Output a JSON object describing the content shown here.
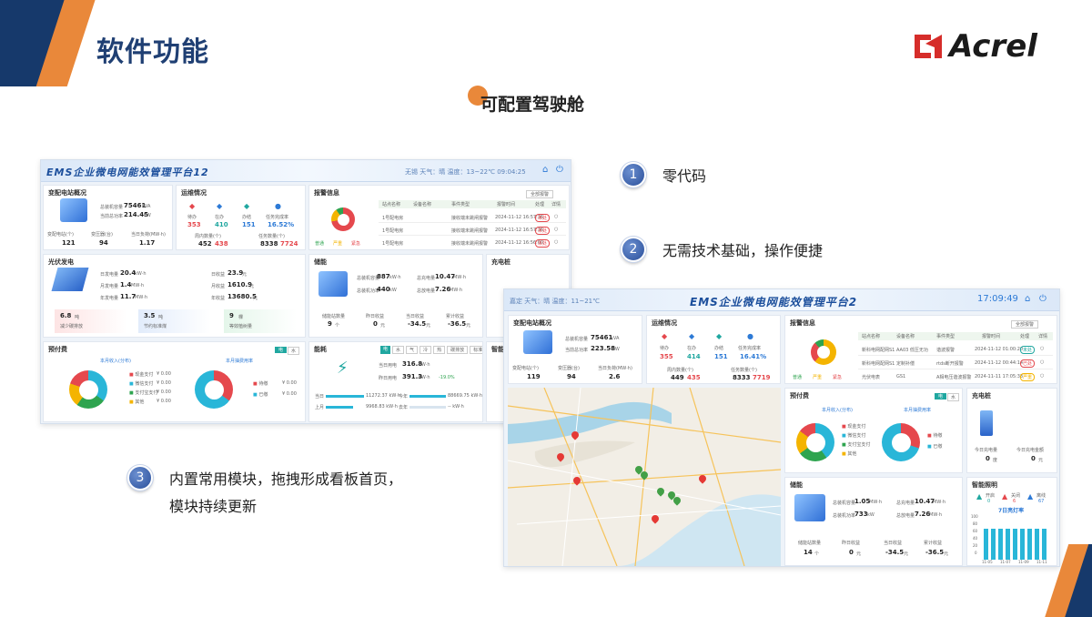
{
  "slide": {
    "title": "软件功能",
    "subtitle": "可配置驾驶舱",
    "brand": "Acrel"
  },
  "features": [
    {
      "num": "1",
      "text": "零代码"
    },
    {
      "num": "2",
      "text": "无需技术基础，操作便捷"
    },
    {
      "num": "3",
      "line1": "内置常用模块，拖拽形成看板首页，",
      "line2": "模块持续更新"
    }
  ],
  "dash1": {
    "title": "EMS企业微电网能效管理平台12",
    "weather": "无锡 天气：晴 温度：13~22℃ 09:04:25",
    "substation": {
      "title": "变配电站概况",
      "cap_label": "总装机容量",
      "cap_value": "75461",
      "cap_unit": "kVA",
      "load_label": "当前总功率",
      "load_value": "214.45",
      "load_unit": "kW",
      "s1_label": "变配电站(个)",
      "s1_value": "121",
      "s2_label": "变压器(台)",
      "s2_value": "94",
      "s3_label": "当日负荷(MW·h)",
      "s3_value": "1.17"
    },
    "ops": {
      "title": "运维情况",
      "items": [
        {
          "label": "待办",
          "value": "353"
        },
        {
          "label": "在办",
          "value": "410"
        },
        {
          "label": "办结",
          "value": "151"
        },
        {
          "label": "任务完成率",
          "value": "16.52%"
        }
      ],
      "a_label": "周内数量(个)",
      "a_value": "452",
      "a_extra": "438",
      "b_label": "任务数量(个)",
      "b_value": "8338",
      "b_extra": "7724"
    },
    "alarm": {
      "title": "报警信息",
      "filter": "全部报警",
      "cols": [
        "站点名称",
        "设备名称",
        "事件类型",
        "报警时间",
        "处理",
        "详情"
      ],
      "rows": [
        {
          "site": "1号配电房",
          "event": "接收端未跳闸报警",
          "time": "2024-11-12 16:57:36",
          "state": "未处"
        },
        {
          "site": "1号配电房",
          "event": "接收端未跳闸报警",
          "time": "2024-11-12 16:57:36",
          "state": "未处"
        },
        {
          "site": "1号配电房",
          "event": "接收端未跳闸报警",
          "time": "2024-11-12 16:56:00",
          "state": "未处"
        }
      ],
      "legend": [
        "普通",
        "严重",
        "紧急"
      ]
    },
    "pv": {
      "title": "光伏发电",
      "d_label": "日发电量",
      "d_value": "20.4",
      "d_unit": "kW·h",
      "m_label": "月发电量",
      "m_value": "1.4",
      "m_unit": "MW·h",
      "y_label": "年发电量",
      "y_value": "11.7",
      "y_unit": "MW·h",
      "di_label": "日收益",
      "di_value": "23.9",
      "mi_label": "月收益",
      "mi_value": "1610.9",
      "yi_label": "年收益",
      "yi_value": "13680.5",
      "unit_yuan": "元",
      "c1_value": "6.8",
      "c1_unit": "吨",
      "c1_label": "减少碳排放",
      "c2_value": "3.5",
      "c2_unit": "吨",
      "c2_label": "节约标准煤",
      "c3_value": "9",
      "c3_unit": "棵",
      "c3_label": "等效植树量"
    },
    "storage": {
      "title": "储能",
      "cap_label": "总装机容量",
      "cap_value": "887",
      "cap_unit": "kW·h",
      "pw_label": "总装机功率",
      "pw_value": "440",
      "pw_unit": "kW",
      "chg_label": "总充电量",
      "chg_value": "10.47",
      "chg_unit": "MW·h",
      "dis_label": "总放电量",
      "dis_value": "7.26",
      "dis_unit": "MW·h",
      "n1_label": "储能站数量",
      "n1_value": "9",
      "n1_unit": "个",
      "n2_label": "昨日收益",
      "n2_value": "0",
      "n3_label": "当日收益",
      "n3_value": "-34.5",
      "n4_label": "累计收益",
      "n4_value": "-36.5",
      "unit_yuan": "元"
    },
    "charge": {
      "title": "充电桩"
    },
    "prepaid": {
      "title": "预付费",
      "tab1": "电",
      "tab2": "水",
      "left_label": "本月收入(分布)",
      "right_label": "本月抽费用率",
      "legend_l": [
        "现金支付",
        "微信支付",
        "支付宝支付",
        "其他"
      ],
      "legend_r": [
        "待缴",
        "已缴"
      ],
      "zero": "¥ 0.00"
    },
    "energy": {
      "title": "能耗",
      "tabs": [
        "电",
        "水",
        "气",
        "冷",
        "热",
        "碳排放",
        "标准煤"
      ],
      "today_label": "当日用电",
      "today_value": "316.8",
      "today_unit": "kW·h",
      "yest_label": "昨日用电",
      "yest_value": "391.3",
      "yest_unit": "kW·h",
      "ratio": "-19.0%",
      "r1": "当日",
      "r1v": "11272.37 kW·h",
      "r2": "上月",
      "r2v": "9968.83 kW·h",
      "r3": "今年",
      "r3v": "88669.75 kW·h",
      "r4": "去年",
      "r4v": "-- kW·h"
    },
    "smart": {
      "title": "智能"
    }
  },
  "dash2": {
    "title": "EMS企业微电网能效管理平台2",
    "weather": "嘉定 天气：晴 温度：11~21℃",
    "clock": "17:09:49",
    "substation": {
      "title": "变配电站概况",
      "cap_label": "总装机容量",
      "cap_value": "75461",
      "cap_unit": "kVA",
      "load_label": "当前总功率",
      "load_value": "223.58",
      "load_unit": "kW",
      "s1_label": "变配电站(个)",
      "s1_value": "119",
      "s2_label": "变压器(台)",
      "s2_value": "94",
      "s3_label": "当日负荷(MW·h)",
      "s3_value": "2.6"
    },
    "ops": {
      "title": "运维情况",
      "items": [
        {
          "label": "待办",
          "value": "355"
        },
        {
          "label": "在办",
          "value": "414"
        },
        {
          "label": "办结",
          "value": "151"
        },
        {
          "label": "任务完成率",
          "value": "16.41%"
        }
      ],
      "a_label": "周内数量(个)",
      "a_value": "449",
      "a_extra": "435",
      "b_label": "任务数量(个)",
      "b_value": "8333",
      "b_extra": "7719"
    },
    "alarm": {
      "title": "报警信息",
      "filter": "全部报警",
      "cols": [
        "站点名称",
        "设备名称",
        "事件类型",
        "报警时间",
        "处理",
        "详情"
      ],
      "rows": [
        {
          "site": "新科电网配网S1",
          "device": "AA03 低压无功",
          "event": "谐波报警",
          "time": "2024-11-12 01:00:20",
          "state": "未处"
        },
        {
          "site": "新科电网配网S1",
          "device": "定制补偿",
          "event": "rtds断开报警",
          "time": "2024-11-12 00:44:14",
          "state": "已处"
        },
        {
          "site": "光伏电表",
          "device": "GS1",
          "event": "A相电压谐波报警",
          "time": "2024-11-11 17:05:33",
          "state": "严重"
        }
      ],
      "legend": [
        "普通",
        "严重",
        "紧急"
      ]
    },
    "prepaid": {
      "title": "预付费",
      "tab1": "电",
      "tab2": "水",
      "left_label": "本月收入(分布)",
      "right_label": "本月抽费用率",
      "legend_l": [
        "现金支付",
        "微信支付",
        "支付宝支付",
        "其他"
      ],
      "legend_r": [
        "待缴",
        "已缴"
      ]
    },
    "charge": {
      "title": "充电桩",
      "today_label": "今日充电量",
      "today_value": "0",
      "today_unit": "度",
      "amount_label": "今日充电金额",
      "amount_value": "0",
      "amount_unit": "元"
    },
    "storage": {
      "title": "储能",
      "cap_label": "总装机容量",
      "cap_value": "1.05",
      "cap_unit": "MW·h",
      "pw_label": "总装机功率",
      "pw_value": "733",
      "pw_unit": "kW",
      "chg_label": "总充电量",
      "chg_value": "10.47",
      "chg_unit": "MW·h",
      "dis_label": "总放电量",
      "dis_value": "7.26",
      "dis_unit": "MW·h",
      "n1_label": "储能站数量",
      "n1_value": "14",
      "n1_unit": "个",
      "n2_label": "昨日收益",
      "n2_value": "0",
      "n3_label": "当日收益",
      "n3_value": "-34.5",
      "n4_label": "累计收益",
      "n4_value": "-36.5",
      "unit_yuan": "元"
    },
    "lighting": {
      "title": "智能照明",
      "items": [
        {
          "label": "开启",
          "value": "0"
        },
        {
          "label": "关闭",
          "value": "6"
        },
        {
          "label": "离线",
          "value": "67"
        }
      ],
      "rate_label": "7日亮灯率",
      "y_ticks": [
        "100",
        "80",
        "60",
        "40",
        "20",
        "0"
      ],
      "x_ticks": [
        "11-05",
        "11-07",
        "11-09",
        "11-11"
      ]
    }
  }
}
